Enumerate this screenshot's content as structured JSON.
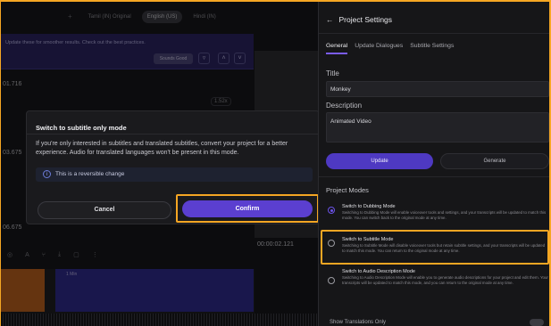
{
  "editor": {
    "lang_tabs": [
      "Tamil (IN) Original",
      "English (US)",
      "Hindi (IN)"
    ],
    "banner_text": "Update these for smoother results. Check out the best practices.",
    "sound_button": "Sounds Good",
    "timestamps": [
      "01.716",
      "03.675",
      "06.675"
    ],
    "speed": "1.52x",
    "clip_label": "1 Min",
    "playback_time": "00:00:02.121",
    "speed2": "7.0"
  },
  "modal": {
    "title": "Switch to subtitle only mode",
    "body": "If you're only interested in subtitles and translated subtitles, convert your project for a better experience. Audio for translated languages won't be present in this mode.",
    "notice": "This is a reversible change",
    "cancel_label": "Cancel",
    "confirm_label": "Confirm"
  },
  "panel": {
    "title": "Project Settings",
    "tabs": [
      "General",
      "Update Dialogues",
      "Subtitle Settings"
    ],
    "title_label": "Title",
    "title_value": "Monkey",
    "description_label": "Description",
    "description_value": "Animated Video",
    "update_label": "Update",
    "generate_label": "Generate",
    "section_title": "Project Modes",
    "modes": [
      {
        "title": "Switch to Dubbing Mode",
        "desc": "Switching to Dubbing Mode will enable voiceover tools and settings, and your transcripts will be updated to match this mode. You can switch back to the original mode at any time."
      },
      {
        "title": "Switch to Subtitle Mode",
        "desc": "Switching to Subtitle Mode will disable voiceover tools but retain subtitle settings, and your transcripts will be updated to match this mode. You can return to the original mode at any time."
      },
      {
        "title": "Switch to Audio Description Mode",
        "desc": "Switching to Audio Description Mode will enable you to generate audio descriptions for your project and edit them. Your transcripts will be updated to match this mode, and you can return to the original mode at any time."
      }
    ],
    "footer_label": "Show Translations Only"
  }
}
